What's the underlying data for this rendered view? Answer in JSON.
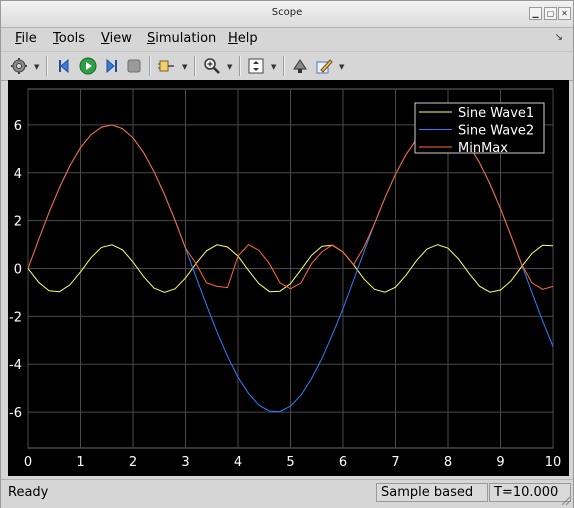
{
  "window": {
    "title": "Scope"
  },
  "menu": [
    {
      "label": "File",
      "hot": "F",
      "rest": "ile"
    },
    {
      "label": "Tools",
      "hot": "T",
      "rest": "ools"
    },
    {
      "label": "View",
      "hot": "V",
      "rest": "iew"
    },
    {
      "label": "Simulation",
      "hot": "S",
      "rest": "imulation"
    },
    {
      "label": "Help",
      "hot": "H",
      "rest": "elp"
    }
  ],
  "toolbar": {
    "icons": [
      "settings-icon",
      "step-back-icon",
      "run-icon",
      "step-forward-icon",
      "stop-icon",
      "signal-selector-icon",
      "zoom-in-icon",
      "fit-axes-icon",
      "highlight-block-icon",
      "style-icon"
    ]
  },
  "colors": {
    "plot_bg": "#000000",
    "grid": "#4a4a4a",
    "axis_text": "#ffffff",
    "sine1": "#ffff66",
    "sine2": "#2f7fff",
    "minmax": "#ff6a33"
  },
  "chart_data": {
    "type": "line",
    "title": "",
    "xlabel": "",
    "ylabel": "",
    "xlim": [
      0,
      10
    ],
    "ylim": [
      -7.5,
      7.5
    ],
    "xticks": [
      "0",
      "1",
      "2",
      "3",
      "4",
      "5",
      "6",
      "7",
      "8",
      "9",
      "10"
    ],
    "yticks": [
      "-6",
      "-4",
      "-2",
      "0",
      "2",
      "4",
      "6"
    ],
    "grid": true,
    "legend_position": "top-right",
    "x": [
      0,
      0.2,
      0.4,
      0.6,
      0.8,
      1.0,
      1.2,
      1.4,
      1.6,
      1.8,
      2.0,
      2.2,
      2.4,
      2.6,
      2.8,
      3.0,
      3.2,
      3.4,
      3.6,
      3.8,
      4.0,
      4.2,
      4.4,
      4.6,
      4.8,
      5.0,
      5.2,
      5.4,
      5.6,
      5.8,
      6.0,
      6.2,
      6.4,
      6.6,
      6.8,
      7.0,
      7.2,
      7.4,
      7.6,
      7.8,
      8.0,
      8.2,
      8.4,
      8.6,
      8.8,
      9.0,
      9.2,
      9.4,
      9.6,
      9.8,
      10.0
    ],
    "series": [
      {
        "name": "Sine Wave1",
        "color": "#ffff66",
        "values": [
          0,
          -0.57,
          -0.93,
          -0.97,
          -0.68,
          -0.14,
          0.45,
          0.88,
          0.99,
          0.78,
          0.27,
          -0.33,
          -0.82,
          -1.0,
          -0.85,
          -0.4,
          0.21,
          0.74,
          0.99,
          0.9,
          0.52,
          -0.08,
          -0.64,
          -0.97,
          -0.95,
          -0.63,
          -0.05,
          0.55,
          0.93,
          0.97,
          0.69,
          0.16,
          -0.44,
          -0.87,
          -0.99,
          -0.78,
          -0.28,
          0.33,
          0.81,
          1.0,
          0.85,
          0.4,
          -0.2,
          -0.74,
          -0.99,
          -0.9,
          -0.52,
          0.07,
          0.63,
          0.97,
          0.95
        ]
      },
      {
        "name": "Sine Wave2",
        "color": "#2f7fff",
        "values": [
          0,
          1.19,
          2.34,
          3.39,
          4.3,
          5.05,
          5.59,
          5.91,
          6.0,
          5.84,
          5.46,
          4.85,
          4.05,
          3.09,
          2.02,
          0.85,
          -0.35,
          -1.53,
          -2.65,
          -3.67,
          -4.54,
          -5.22,
          -5.71,
          -5.96,
          -5.98,
          -5.75,
          -5.29,
          -4.6,
          -3.75,
          -2.75,
          -1.68,
          -0.5,
          0.7,
          1.87,
          2.96,
          3.94,
          4.76,
          5.4,
          5.81,
          5.99,
          5.94,
          5.65,
          5.14,
          4.42,
          3.53,
          2.5,
          1.37,
          0.19,
          -1.01,
          -2.18,
          -3.26
        ]
      },
      {
        "name": "MinMax",
        "color": "#ff6a33",
        "values": [
          0,
          1.19,
          2.34,
          3.39,
          4.3,
          5.05,
          5.59,
          5.91,
          6.0,
          5.84,
          5.46,
          4.85,
          4.05,
          3.09,
          2.02,
          0.85,
          0.21,
          -0.6,
          -0.75,
          -0.8,
          0.52,
          1.0,
          0.75,
          0.2,
          -0.6,
          -0.85,
          -0.6,
          0.2,
          0.7,
          0.98,
          0.69,
          0.16,
          0.9,
          1.87,
          2.96,
          3.94,
          4.76,
          5.4,
          5.81,
          5.99,
          5.94,
          5.65,
          5.14,
          4.42,
          3.53,
          2.5,
          1.37,
          0.19,
          -0.6,
          -0.87,
          -0.75
        ]
      }
    ]
  },
  "status": {
    "ready": "Ready",
    "mode": "Sample based",
    "time": "T=10.000"
  }
}
